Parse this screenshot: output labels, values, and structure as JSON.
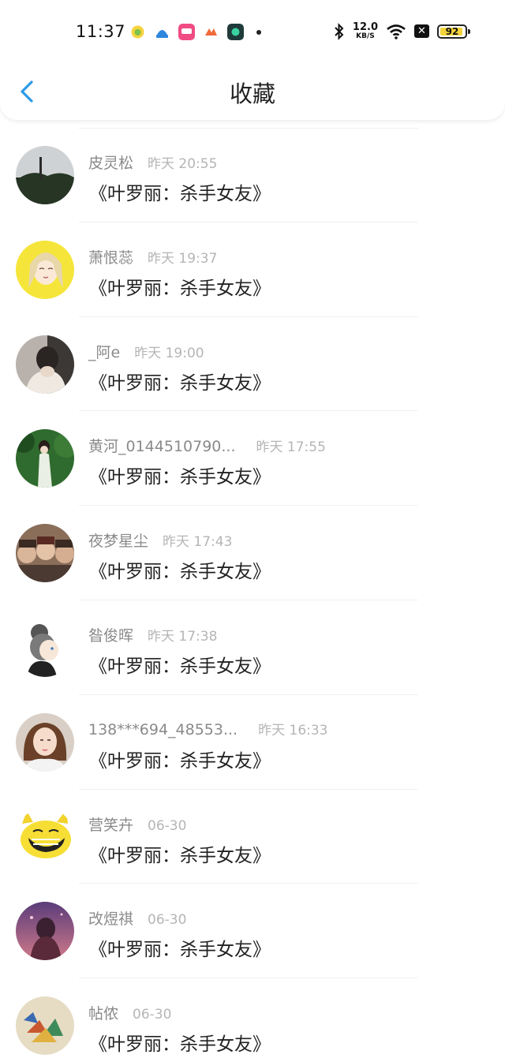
{
  "status_bar": {
    "time": "11:37",
    "net_speed_value": "12.0",
    "net_speed_unit": "KB/S",
    "battery_level": "92",
    "icons": [
      "bluetooth-icon",
      "wifi-icon",
      "x-notify-icon",
      "battery-icon"
    ],
    "app_icons": [
      "app-icon-1",
      "app-icon-2",
      "app-icon-3",
      "app-icon-4",
      "app-icon-5"
    ]
  },
  "header": {
    "title": "收藏",
    "back_icon": "chevron-left-icon"
  },
  "colors": {
    "accent": "#2d9ae8",
    "username": "#8a8a8a",
    "timestamp": "#b5b5b5",
    "text": "#222222"
  },
  "items": [
    {
      "username": "皮灵松",
      "time": "昨天 20:55",
      "text": "《叶罗丽：杀手女友》"
    },
    {
      "username": "萧恨蕊",
      "time": "昨天 19:37",
      "text": "《叶罗丽：杀手女友》"
    },
    {
      "username": "_阿e",
      "time": "昨天 19:00",
      "text": "《叶罗丽：杀手女友》"
    },
    {
      "username": "黄河_0144510790...",
      "time": "昨天 17:55",
      "text": "《叶罗丽：杀手女友》"
    },
    {
      "username": "夜梦星尘",
      "time": "昨天 17:43",
      "text": "《叶罗丽：杀手女友》"
    },
    {
      "username": "昝俊晖",
      "time": "昨天 17:38",
      "text": "《叶罗丽：杀手女友》"
    },
    {
      "username": "138***694_48553...",
      "time": "昨天 16:33",
      "text": "《叶罗丽：杀手女友》"
    },
    {
      "username": "营笑卉",
      "time": "06-30",
      "text": "《叶罗丽：杀手女友》"
    },
    {
      "username": "改煜祺",
      "time": "06-30",
      "text": "《叶罗丽：杀手女友》"
    },
    {
      "username": "帖侬",
      "time": "06-30",
      "text": "《叶罗丽：杀手女友》"
    }
  ]
}
